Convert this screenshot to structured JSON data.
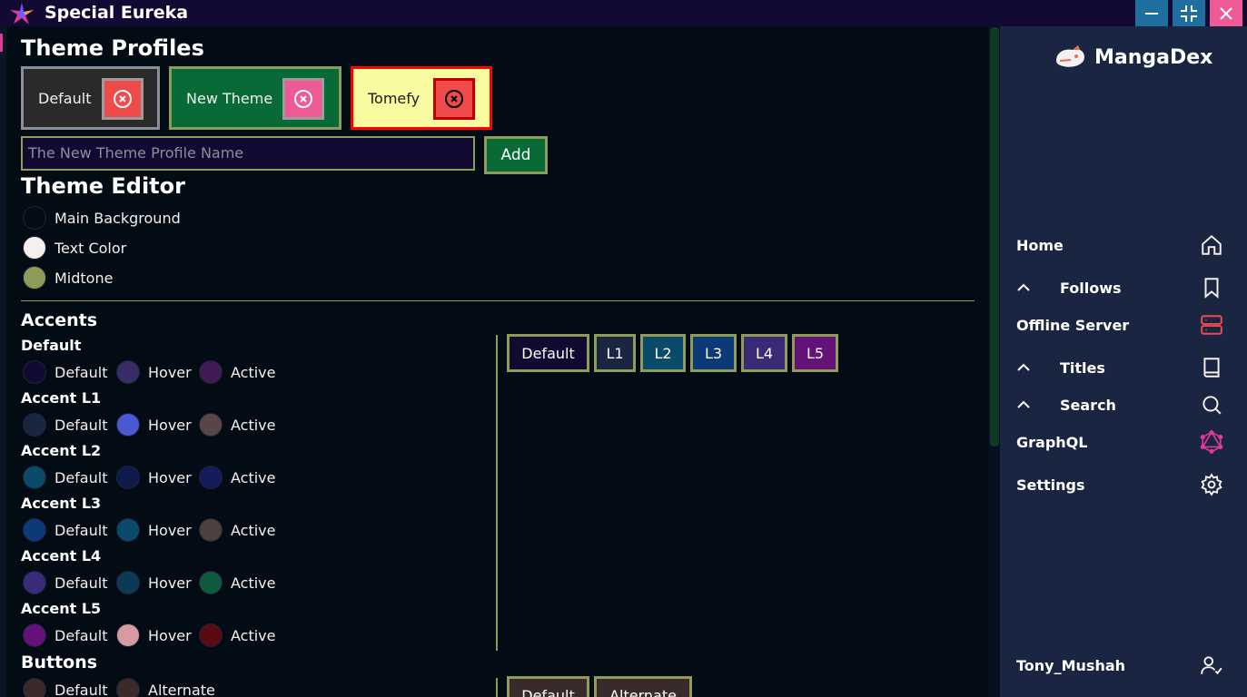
{
  "window": {
    "title": "Special Eureka"
  },
  "profiles": {
    "heading": "Theme Profiles",
    "items": [
      {
        "name": "Default"
      },
      {
        "name": "New Theme"
      },
      {
        "name": "Tomefy"
      }
    ],
    "new_profile_placeholder": "The New Theme Profile Name",
    "add_label": "Add"
  },
  "editor": {
    "heading": "Theme Editor",
    "base": [
      {
        "label": "Main Background",
        "color": "#030b14"
      },
      {
        "label": "Text Color",
        "color": "#f5f0ee"
      },
      {
        "label": "Midtone",
        "color": "#8e9b59"
      }
    ]
  },
  "accents": {
    "heading": "Accents",
    "groups": [
      {
        "title": "Default",
        "default": "#120a32",
        "hover": "#3a2c66",
        "active": "#431a55",
        "labels": [
          "Default",
          "Hover",
          "Active"
        ]
      },
      {
        "title": "Accent L1",
        "default": "#1a2541",
        "hover": "#4c58d6",
        "active": "#594545",
        "labels": [
          "Default",
          "Hover",
          "Active"
        ]
      },
      {
        "title": "Accent L2",
        "default": "#0a4a6a",
        "hover": "#0d1a4a",
        "active": "#141a5c",
        "labels": [
          "Default",
          "Hover",
          "Active"
        ]
      },
      {
        "title": "Accent L3",
        "default": "#0c3a78",
        "hover": "#0a4a6a",
        "active": "#4f4040",
        "labels": [
          "Default",
          "Hover",
          "Active"
        ]
      },
      {
        "title": "Accent L4",
        "default": "#3b2a78",
        "hover": "#0c3a55",
        "active": "#0f5a3a",
        "labels": [
          "Default",
          "Hover",
          "Active"
        ]
      },
      {
        "title": "Accent L5",
        "default": "#63127a",
        "hover": "#d69aa0",
        "active": "#5a0a12",
        "labels": [
          "Default",
          "Hover",
          "Active"
        ]
      }
    ],
    "preview": [
      {
        "label": "Default",
        "color": "#120a32"
      },
      {
        "label": "L1",
        "color": "#1a2541"
      },
      {
        "label": "L2",
        "color": "#0a4a6a"
      },
      {
        "label": "L3",
        "color": "#0c3a78"
      },
      {
        "label": "L4",
        "color": "#3b2a78"
      },
      {
        "label": "L5",
        "color": "#63127a"
      }
    ]
  },
  "buttons": {
    "heading": "Buttons",
    "swatches": [
      {
        "label": "Default",
        "color": "#3a2a2a"
      },
      {
        "label": "Alternate",
        "color": "#3a2a2a"
      }
    ],
    "preview": [
      {
        "label": "Default"
      },
      {
        "label": "Alternate"
      }
    ]
  },
  "sidebar": {
    "brand": "MangaDex",
    "nav": [
      {
        "label": "Home",
        "icon": "home-icon"
      },
      {
        "label": "Follows",
        "icon": "bookmark-icon",
        "expandable": true
      },
      {
        "label": "Offline Server",
        "icon": "server-icon"
      },
      {
        "label": "Titles",
        "icon": "book-icon",
        "expandable": true
      },
      {
        "label": "Search",
        "icon": "search-icon",
        "expandable": true
      },
      {
        "label": "GraphQL",
        "icon": "graphql-icon"
      },
      {
        "label": "Settings",
        "icon": "gear-icon"
      }
    ],
    "user": "Tony_Mushah"
  },
  "colors": {
    "midtone": "#8e9b59",
    "danger": "#e94b4b",
    "accent_pink": "#e0399b"
  }
}
